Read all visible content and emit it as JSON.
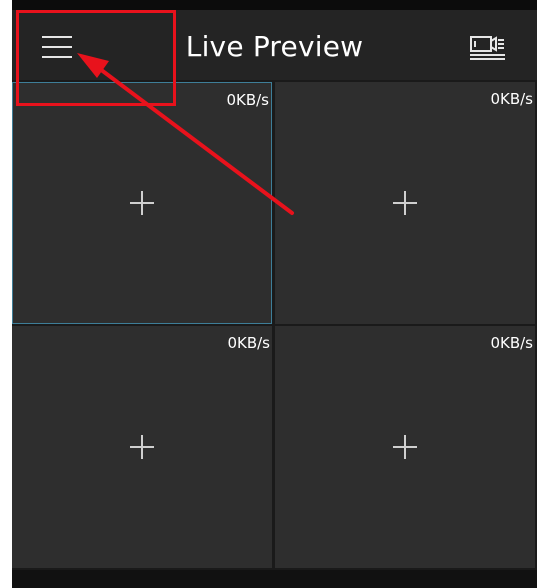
{
  "header": {
    "title": "Live Preview",
    "menu_icon": "hamburger-menu-icon",
    "playback_icon": "video-playback-list-icon"
  },
  "channels": [
    {
      "speed": "0KB/s",
      "selected": true
    },
    {
      "speed": "0KB/s",
      "selected": false
    },
    {
      "speed": "0KB/s",
      "selected": false
    },
    {
      "speed": "0KB/s",
      "selected": false
    }
  ],
  "add_icon": "plus-icon",
  "colors": {
    "background": "#1c1c1c",
    "topbar": "#242424",
    "cell": "#2e2e2e",
    "selected_border": "#3e7e98",
    "annotation": "#e8121c"
  }
}
